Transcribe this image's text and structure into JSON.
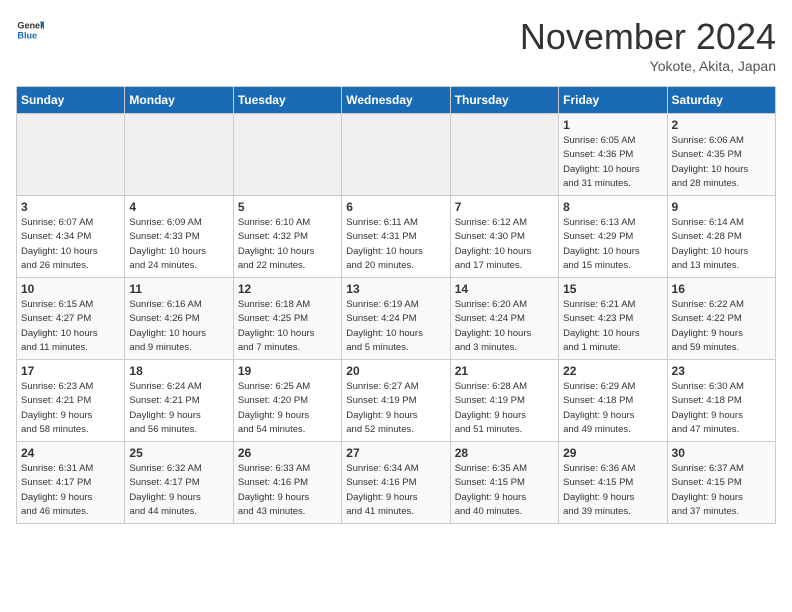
{
  "logo": {
    "general": "General",
    "blue": "Blue"
  },
  "title": "November 2024",
  "location": "Yokote, Akita, Japan",
  "days_of_week": [
    "Sunday",
    "Monday",
    "Tuesday",
    "Wednesday",
    "Thursday",
    "Friday",
    "Saturday"
  ],
  "weeks": [
    [
      {
        "day": "",
        "info": ""
      },
      {
        "day": "",
        "info": ""
      },
      {
        "day": "",
        "info": ""
      },
      {
        "day": "",
        "info": ""
      },
      {
        "day": "",
        "info": ""
      },
      {
        "day": "1",
        "info": "Sunrise: 6:05 AM\nSunset: 4:36 PM\nDaylight: 10 hours\nand 31 minutes."
      },
      {
        "day": "2",
        "info": "Sunrise: 6:06 AM\nSunset: 4:35 PM\nDaylight: 10 hours\nand 28 minutes."
      }
    ],
    [
      {
        "day": "3",
        "info": "Sunrise: 6:07 AM\nSunset: 4:34 PM\nDaylight: 10 hours\nand 26 minutes."
      },
      {
        "day": "4",
        "info": "Sunrise: 6:09 AM\nSunset: 4:33 PM\nDaylight: 10 hours\nand 24 minutes."
      },
      {
        "day": "5",
        "info": "Sunrise: 6:10 AM\nSunset: 4:32 PM\nDaylight: 10 hours\nand 22 minutes."
      },
      {
        "day": "6",
        "info": "Sunrise: 6:11 AM\nSunset: 4:31 PM\nDaylight: 10 hours\nand 20 minutes."
      },
      {
        "day": "7",
        "info": "Sunrise: 6:12 AM\nSunset: 4:30 PM\nDaylight: 10 hours\nand 17 minutes."
      },
      {
        "day": "8",
        "info": "Sunrise: 6:13 AM\nSunset: 4:29 PM\nDaylight: 10 hours\nand 15 minutes."
      },
      {
        "day": "9",
        "info": "Sunrise: 6:14 AM\nSunset: 4:28 PM\nDaylight: 10 hours\nand 13 minutes."
      }
    ],
    [
      {
        "day": "10",
        "info": "Sunrise: 6:15 AM\nSunset: 4:27 PM\nDaylight: 10 hours\nand 11 minutes."
      },
      {
        "day": "11",
        "info": "Sunrise: 6:16 AM\nSunset: 4:26 PM\nDaylight: 10 hours\nand 9 minutes."
      },
      {
        "day": "12",
        "info": "Sunrise: 6:18 AM\nSunset: 4:25 PM\nDaylight: 10 hours\nand 7 minutes."
      },
      {
        "day": "13",
        "info": "Sunrise: 6:19 AM\nSunset: 4:24 PM\nDaylight: 10 hours\nand 5 minutes."
      },
      {
        "day": "14",
        "info": "Sunrise: 6:20 AM\nSunset: 4:24 PM\nDaylight: 10 hours\nand 3 minutes."
      },
      {
        "day": "15",
        "info": "Sunrise: 6:21 AM\nSunset: 4:23 PM\nDaylight: 10 hours\nand 1 minute."
      },
      {
        "day": "16",
        "info": "Sunrise: 6:22 AM\nSunset: 4:22 PM\nDaylight: 9 hours\nand 59 minutes."
      }
    ],
    [
      {
        "day": "17",
        "info": "Sunrise: 6:23 AM\nSunset: 4:21 PM\nDaylight: 9 hours\nand 58 minutes."
      },
      {
        "day": "18",
        "info": "Sunrise: 6:24 AM\nSunset: 4:21 PM\nDaylight: 9 hours\nand 56 minutes."
      },
      {
        "day": "19",
        "info": "Sunrise: 6:25 AM\nSunset: 4:20 PM\nDaylight: 9 hours\nand 54 minutes."
      },
      {
        "day": "20",
        "info": "Sunrise: 6:27 AM\nSunset: 4:19 PM\nDaylight: 9 hours\nand 52 minutes."
      },
      {
        "day": "21",
        "info": "Sunrise: 6:28 AM\nSunset: 4:19 PM\nDaylight: 9 hours\nand 51 minutes."
      },
      {
        "day": "22",
        "info": "Sunrise: 6:29 AM\nSunset: 4:18 PM\nDaylight: 9 hours\nand 49 minutes."
      },
      {
        "day": "23",
        "info": "Sunrise: 6:30 AM\nSunset: 4:18 PM\nDaylight: 9 hours\nand 47 minutes."
      }
    ],
    [
      {
        "day": "24",
        "info": "Sunrise: 6:31 AM\nSunset: 4:17 PM\nDaylight: 9 hours\nand 46 minutes."
      },
      {
        "day": "25",
        "info": "Sunrise: 6:32 AM\nSunset: 4:17 PM\nDaylight: 9 hours\nand 44 minutes."
      },
      {
        "day": "26",
        "info": "Sunrise: 6:33 AM\nSunset: 4:16 PM\nDaylight: 9 hours\nand 43 minutes."
      },
      {
        "day": "27",
        "info": "Sunrise: 6:34 AM\nSunset: 4:16 PM\nDaylight: 9 hours\nand 41 minutes."
      },
      {
        "day": "28",
        "info": "Sunrise: 6:35 AM\nSunset: 4:15 PM\nDaylight: 9 hours\nand 40 minutes."
      },
      {
        "day": "29",
        "info": "Sunrise: 6:36 AM\nSunset: 4:15 PM\nDaylight: 9 hours\nand 39 minutes."
      },
      {
        "day": "30",
        "info": "Sunrise: 6:37 AM\nSunset: 4:15 PM\nDaylight: 9 hours\nand 37 minutes."
      }
    ]
  ]
}
